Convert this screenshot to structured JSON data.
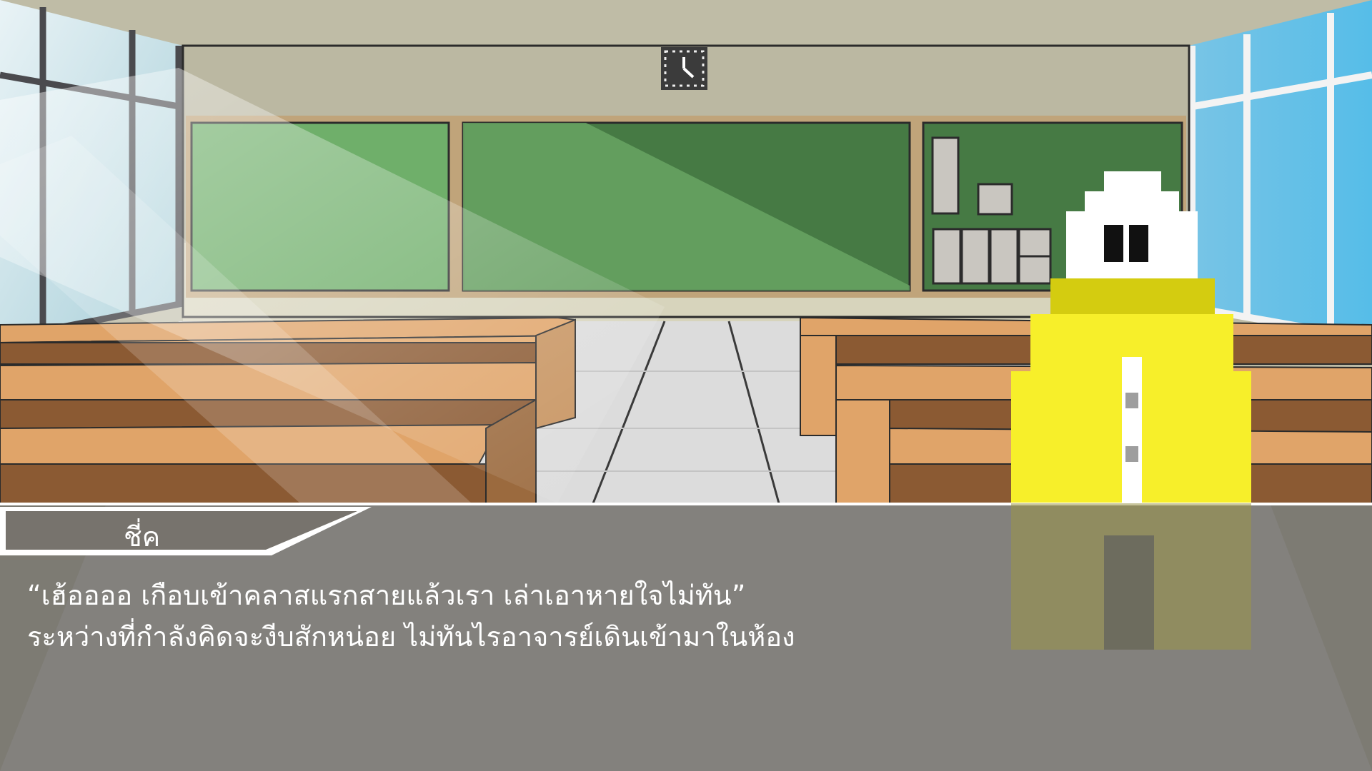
{
  "game": {
    "dialogue": {
      "speaker": "ชี่ค",
      "lines": [
        "“เฮ้ออออ เกือบเข้าคลาสแรกสายแล้วเรา เล่าเอาหายใจไม่ทัน”",
        "ระหว่างที่กำลังคิดจะงีบสักหน่อย ไม่ทันไรอาจารย์เดินเข้ามาในห้อง"
      ]
    },
    "colors": {
      "chalkboard": "#467a44",
      "desk_top": "#e0a469",
      "character_body": "#f7ef2a",
      "dialogue_panel": "#6f6c68"
    }
  }
}
